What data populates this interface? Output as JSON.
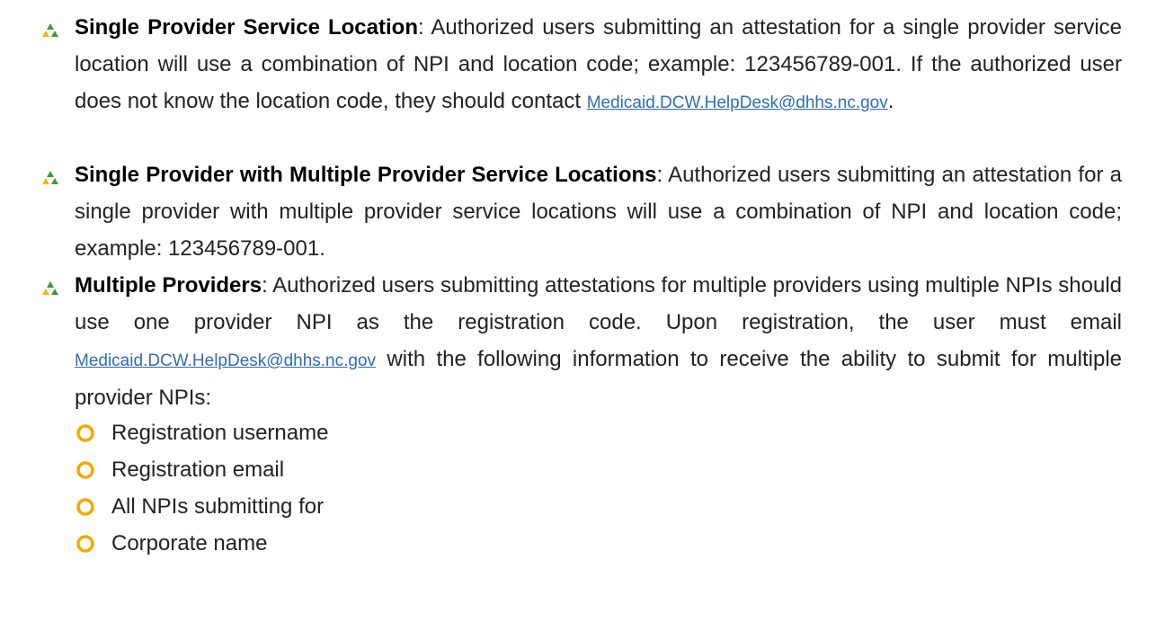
{
  "colors": {
    "text": "#222222",
    "lead_text": "#000000",
    "link": "#2f6db5",
    "bullet_icon_green": "#3a9a3a",
    "bullet_icon_gold": "#f2b705",
    "sub_bullet_icon": "#f5a800"
  },
  "icons": {
    "main_bullet": "tri-leaf-bullet-icon",
    "sub_bullet": "hollow-ring-bullet-icon"
  },
  "bullets": [
    {
      "lead": "Single Provider Service Location",
      "text_before_link": ": Authorized users submitting an attestation for a single provider service location will use a combination of NPI and location code; example: 123456789-001. If the authorized user does not know the location code, they should contact ",
      "link": "Medicaid.DCW.HelpDesk@dhhs.nc.gov",
      "text_after_link": "."
    },
    {
      "lead": "Single Provider with Multiple Provider Service Locations",
      "text": ": Authorized users submitting an attestation for a single provider with multiple provider service locations will use a combination of NPI and location code; example: 123456789-001."
    },
    {
      "lead": "Multiple Providers",
      "text_before_link": ": Authorized users submitting attestations for multiple providers using multiple NPIs should use one provider NPI as the registration code. Upon registration, the user must email ",
      "link": "Medicaid.DCW.HelpDesk@dhhs.nc.gov",
      "text_after_link": " with the following information to receive the ability to submit for multiple provider NPIs:"
    }
  ],
  "sub_items": [
    "Registration username",
    "Registration email",
    "All NPIs submitting for",
    "Corporate name"
  ]
}
